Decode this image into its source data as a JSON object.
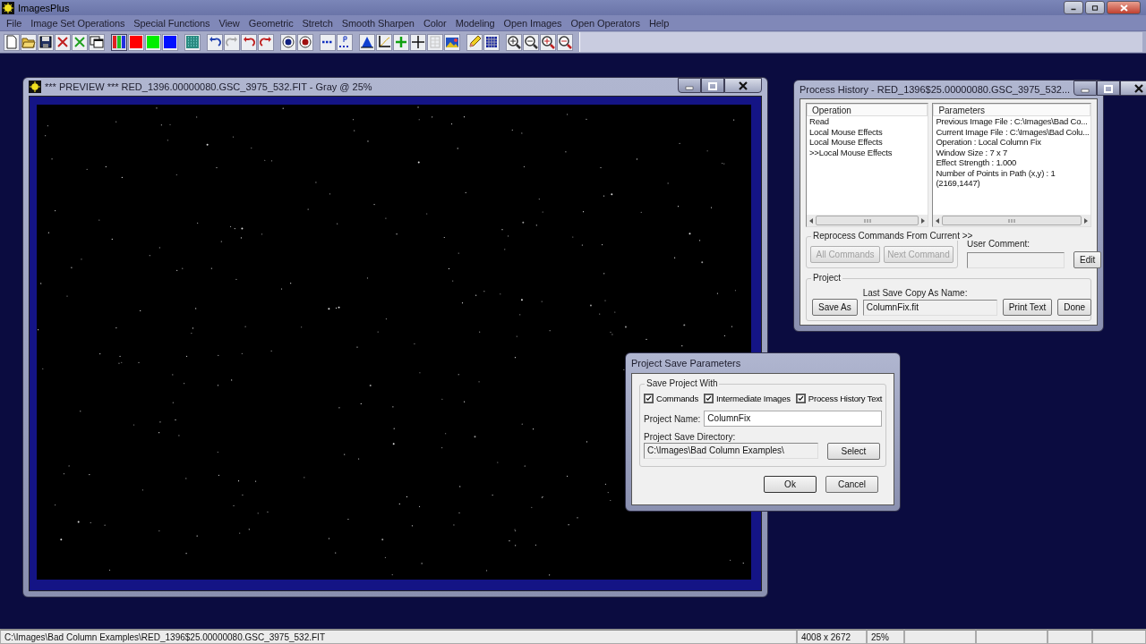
{
  "app": {
    "title": "ImagesPlus"
  },
  "menu": [
    "File",
    "Image Set Operations",
    "Special Functions",
    "View",
    "Geometric",
    "Stretch",
    "Smooth Sharpen",
    "Color",
    "Modeling",
    "Open Images",
    "Open Operators",
    "Help"
  ],
  "preview_window": {
    "title": "*** PREVIEW *** RED_1396.00000080.GSC_3975_532.FIT - Gray @ 25%"
  },
  "process_history": {
    "title": "Process History - RED_1396$25.00000080.GSC_3975_532...",
    "operations_header": "Operation",
    "operations": [
      "Read",
      "Local Mouse Effects",
      "Local Mouse Effects",
      ">>Local Mouse Effects"
    ],
    "parameters_header": "Parameters",
    "parameters": [
      "Previous Image File : C:\\Images\\Bad Co...",
      "Current Image File : C:\\Images\\Bad Colu...",
      "Operation : Local Column Fix",
      "Window Size : 7 x 7",
      "Effect Strength : 1.000",
      "Number of Points in Path (x,y) : 1",
      "(2169,1447)"
    ],
    "reprocess": {
      "legend": "Reprocess Commands From Current >>",
      "buttons": [
        {
          "label": "All Commands",
          "disabled": true
        },
        {
          "label": "Next Command",
          "disabled": true
        }
      ]
    },
    "user_comment_label": "User Comment:",
    "edit_button": "Edit",
    "project": {
      "legend": "Project",
      "save_as": "Save As",
      "last_save_label": "Last Save Copy As Name:",
      "last_save_value": "ColumnFix.fit",
      "print_text": "Print Text",
      "done": "Done"
    }
  },
  "save_dialog": {
    "title": "Project Save Parameters",
    "group_legend": "Save Project With",
    "options": [
      {
        "label": "Commands",
        "checked": true
      },
      {
        "label": "Intermediate Images",
        "checked": true
      },
      {
        "label": "Process History Text",
        "checked": true
      }
    ],
    "name_label": "Project Name:",
    "name_value": "ColumnFix",
    "dir_label": "Project Save Directory:",
    "dir_value": "C:\\Images\\Bad Column Examples\\",
    "select": "Select",
    "ok": "Ok",
    "cancel": "Cancel"
  },
  "status_bar": {
    "path": "C:\\Images\\Bad Column Examples\\RED_1396$25.00000080.GSC_3975_532.FIT",
    "dimensions": "4008 x 2672",
    "zoom": "25%"
  }
}
